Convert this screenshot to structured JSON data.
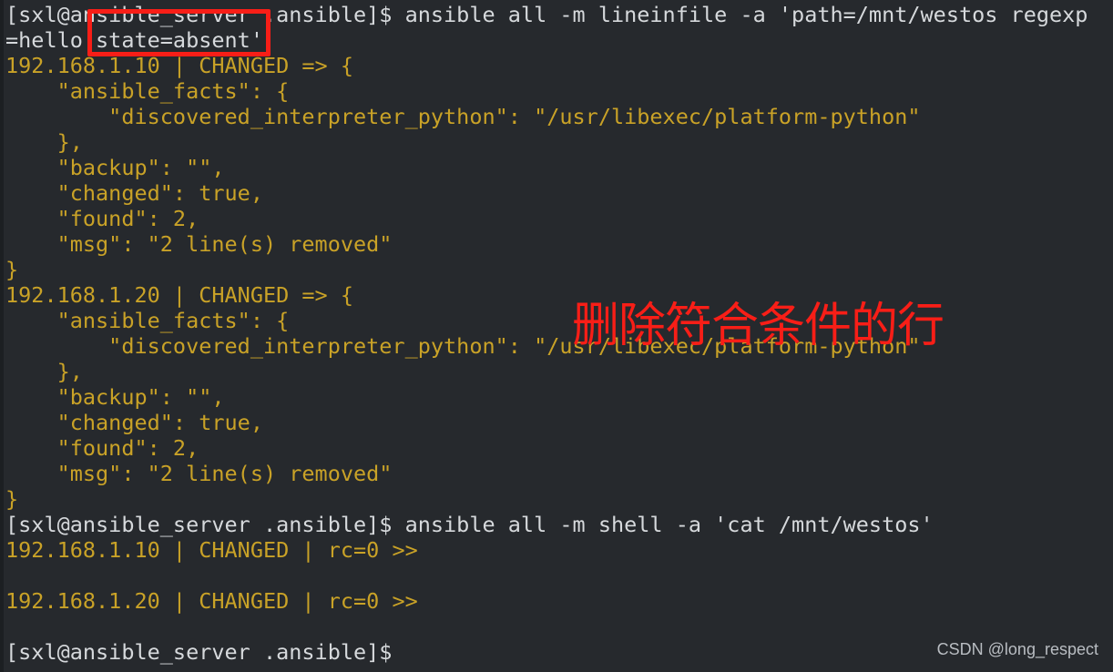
{
  "terminal": {
    "background_color": "#26292d",
    "foreground_color": "#d6d9dc",
    "changed_color": "#c9a227",
    "annotation_color": "#f81e17",
    "prompt": "[sxl@ansible_server .ansible]$",
    "lines": [
      {
        "id": "cmd-lineinfile",
        "kind": "command",
        "text": "[sxl@ansible_server .ansible]$ ansible all -m lineinfile -a 'path=/mnt/westos regexp"
      },
      {
        "id": "cmd-lineinfile-wrap",
        "kind": "command",
        "text": "=hello state=absent'"
      },
      {
        "id": "host-10-changed",
        "kind": "changed",
        "text": "192.168.1.10 | CHANGED => {"
      },
      {
        "id": "host-10-facts-open",
        "kind": "changed",
        "text": "    \"ansible_facts\": {"
      },
      {
        "id": "host-10-interp",
        "kind": "changed",
        "text": "        \"discovered_interpreter_python\": \"/usr/libexec/platform-python\""
      },
      {
        "id": "host-10-facts-close",
        "kind": "changed",
        "text": "    },"
      },
      {
        "id": "host-10-backup",
        "kind": "changed",
        "text": "    \"backup\": \"\","
      },
      {
        "id": "host-10-changed-key",
        "kind": "changed",
        "text": "    \"changed\": true,"
      },
      {
        "id": "host-10-found",
        "kind": "changed",
        "text": "    \"found\": 2,"
      },
      {
        "id": "host-10-msg",
        "kind": "changed",
        "text": "    \"msg\": \"2 line(s) removed\""
      },
      {
        "id": "host-10-close",
        "kind": "changed",
        "text": "}"
      },
      {
        "id": "host-20-changed",
        "kind": "changed",
        "text": "192.168.1.20 | CHANGED => {"
      },
      {
        "id": "host-20-facts-open",
        "kind": "changed",
        "text": "    \"ansible_facts\": {"
      },
      {
        "id": "host-20-interp",
        "kind": "changed",
        "text": "        \"discovered_interpreter_python\": \"/usr/libexec/platform-python\""
      },
      {
        "id": "host-20-facts-close",
        "kind": "changed",
        "text": "    },"
      },
      {
        "id": "host-20-backup",
        "kind": "changed",
        "text": "    \"backup\": \"\","
      },
      {
        "id": "host-20-changed-key",
        "kind": "changed",
        "text": "    \"changed\": true,"
      },
      {
        "id": "host-20-found",
        "kind": "changed",
        "text": "    \"found\": 2,"
      },
      {
        "id": "host-20-msg",
        "kind": "changed",
        "text": "    \"msg\": \"2 line(s) removed\""
      },
      {
        "id": "host-20-close",
        "kind": "changed",
        "text": "}"
      },
      {
        "id": "cmd-cat",
        "kind": "command",
        "text": "[sxl@ansible_server .ansible]$ ansible all -m shell -a 'cat /mnt/westos'"
      },
      {
        "id": "shell-10-rc",
        "kind": "changed",
        "text": "192.168.1.10 | CHANGED | rc=0 >>"
      },
      {
        "id": "blank-1",
        "kind": "blank",
        "text": " "
      },
      {
        "id": "shell-20-rc",
        "kind": "changed",
        "text": "192.168.1.20 | CHANGED | rc=0 >>"
      },
      {
        "id": "blank-2",
        "kind": "blank",
        "text": " "
      },
      {
        "id": "prompt-final",
        "kind": "command",
        "text": "[sxl@ansible_server .ansible]$"
      }
    ]
  },
  "annotations": {
    "highlight_box_target": "state=absent'",
    "note_text": "删除符合条件的行"
  },
  "watermark": {
    "text": "CSDN @long_respect"
  }
}
